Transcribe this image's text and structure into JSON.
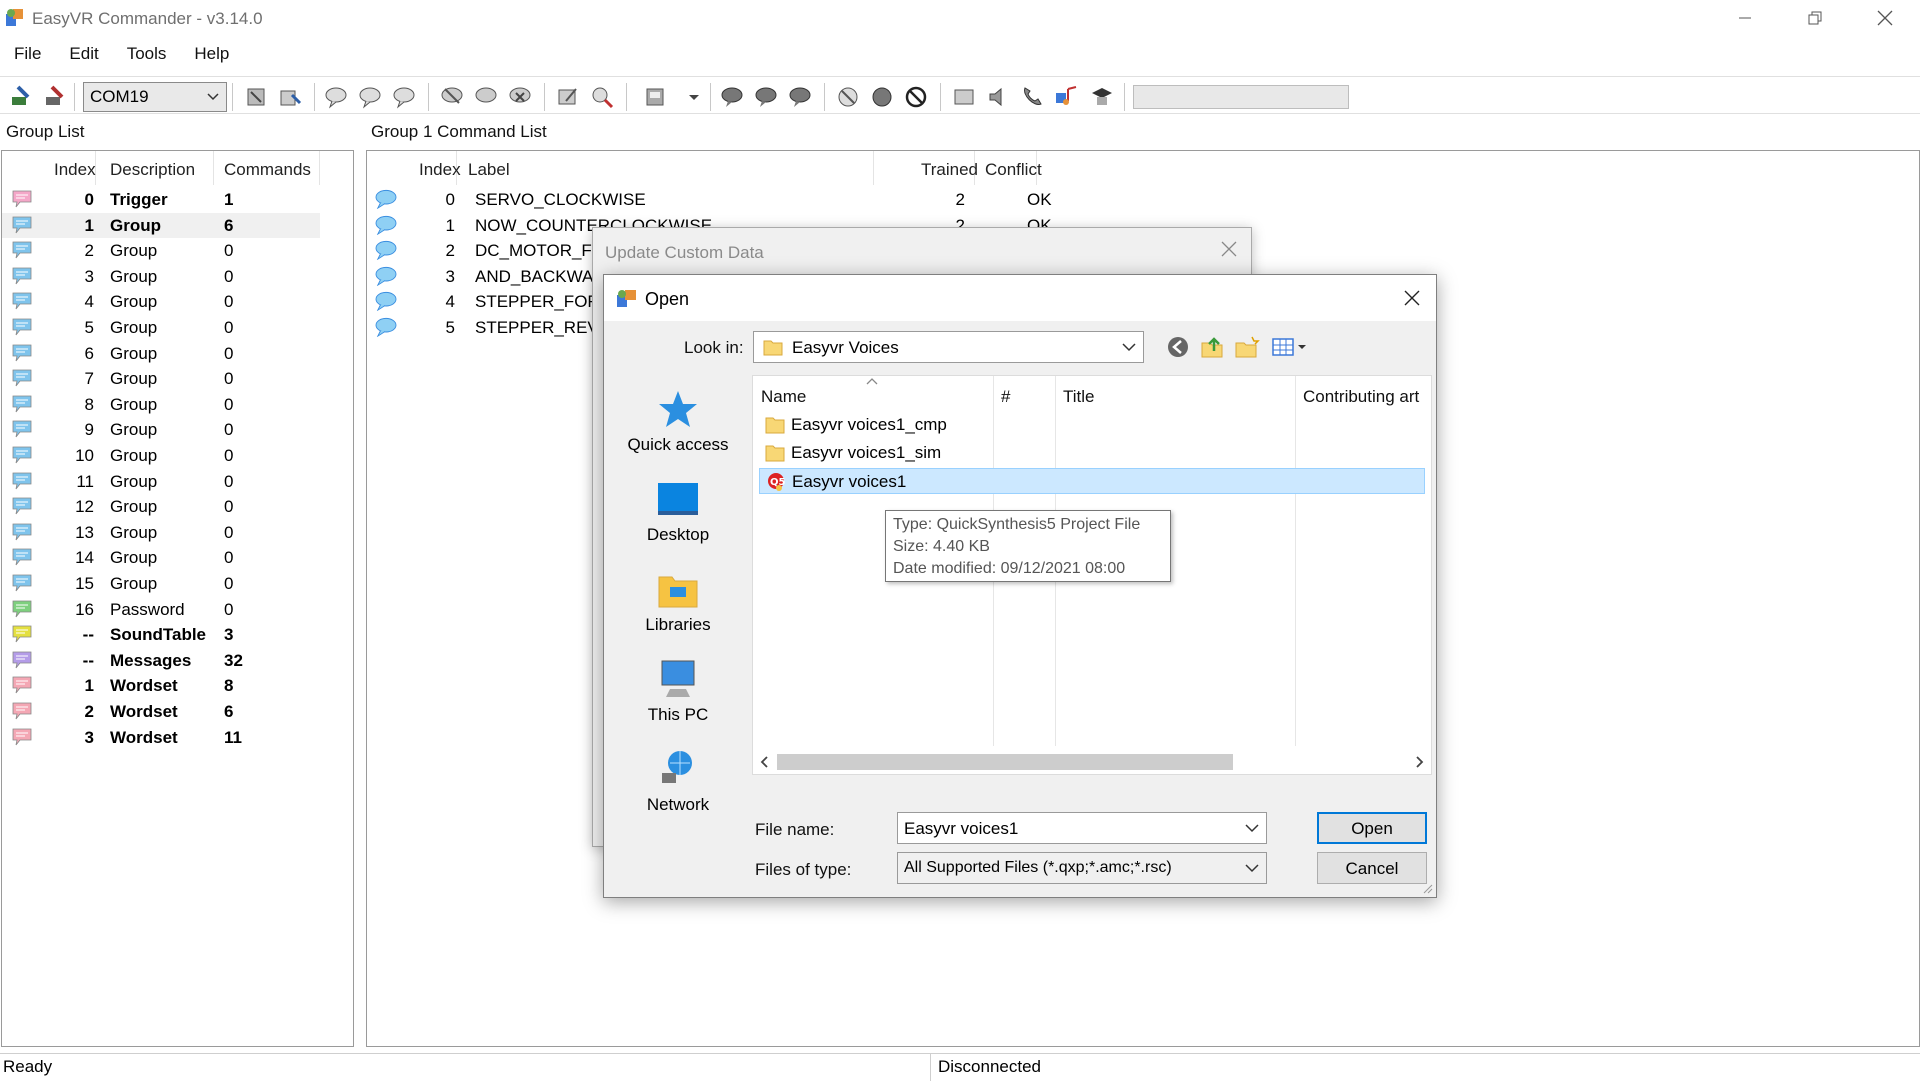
{
  "window": {
    "title": "EasyVR Commander - v3.14.0"
  },
  "menu": [
    "File",
    "Edit",
    "Tools",
    "Help"
  ],
  "toolbar": {
    "com_port": "COM19"
  },
  "group_list": {
    "header": "Group List",
    "columns": [
      "Index",
      "Description",
      "Commands"
    ],
    "rows": [
      {
        "index": "0",
        "description": "Trigger",
        "commands": "1",
        "bold": true,
        "color": "#f4a7c8"
      },
      {
        "index": "1",
        "description": "Group",
        "commands": "6",
        "bold": true,
        "color": "#7fc4ec"
      },
      {
        "index": "2",
        "description": "Group",
        "commands": "0",
        "bold": false,
        "color": "#7fc4ec"
      },
      {
        "index": "3",
        "description": "Group",
        "commands": "0",
        "bold": false,
        "color": "#7fc4ec"
      },
      {
        "index": "4",
        "description": "Group",
        "commands": "0",
        "bold": false,
        "color": "#7fc4ec"
      },
      {
        "index": "5",
        "description": "Group",
        "commands": "0",
        "bold": false,
        "color": "#7fc4ec"
      },
      {
        "index": "6",
        "description": "Group",
        "commands": "0",
        "bold": false,
        "color": "#7fc4ec"
      },
      {
        "index": "7",
        "description": "Group",
        "commands": "0",
        "bold": false,
        "color": "#7fc4ec"
      },
      {
        "index": "8",
        "description": "Group",
        "commands": "0",
        "bold": false,
        "color": "#7fc4ec"
      },
      {
        "index": "9",
        "description": "Group",
        "commands": "0",
        "bold": false,
        "color": "#7fc4ec"
      },
      {
        "index": "10",
        "description": "Group",
        "commands": "0",
        "bold": false,
        "color": "#7fc4ec"
      },
      {
        "index": "11",
        "description": "Group",
        "commands": "0",
        "bold": false,
        "color": "#7fc4ec"
      },
      {
        "index": "12",
        "description": "Group",
        "commands": "0",
        "bold": false,
        "color": "#7fc4ec"
      },
      {
        "index": "13",
        "description": "Group",
        "commands": "0",
        "bold": false,
        "color": "#7fc4ec"
      },
      {
        "index": "14",
        "description": "Group",
        "commands": "0",
        "bold": false,
        "color": "#7fc4ec"
      },
      {
        "index": "15",
        "description": "Group",
        "commands": "0",
        "bold": false,
        "color": "#7fc4ec"
      },
      {
        "index": "16",
        "description": "Password",
        "commands": "0",
        "bold": false,
        "color": "#7ed07e"
      },
      {
        "index": "--",
        "description": "SoundTable",
        "commands": "3",
        "bold": true,
        "color": "#e4e040"
      },
      {
        "index": "--",
        "description": "Messages",
        "commands": "32",
        "bold": true,
        "color": "#b49ce8"
      },
      {
        "index": "1",
        "description": "Wordset",
        "commands": "8",
        "bold": true,
        "color": "#f4a7b4"
      },
      {
        "index": "2",
        "description": "Wordset",
        "commands": "6",
        "bold": true,
        "color": "#f4a7b4"
      },
      {
        "index": "3",
        "description": "Wordset",
        "commands": "11",
        "bold": true,
        "color": "#f4a7b4"
      }
    ]
  },
  "command_list": {
    "header": "Group 1 Command List",
    "columns": [
      "Index",
      "Label",
      "Trained",
      "Conflict"
    ],
    "rows": [
      {
        "index": "0",
        "label": "SERVO_CLOCKWISE",
        "trained": "2",
        "conflict": "OK"
      },
      {
        "index": "1",
        "label": "NOW_COUNTERCLOCKWISE",
        "trained": "2",
        "conflict": "OK"
      },
      {
        "index": "2",
        "label": "DC_MOTOR_FO",
        "trained": "",
        "conflict": ""
      },
      {
        "index": "3",
        "label": "AND_BACKWAR",
        "trained": "",
        "conflict": ""
      },
      {
        "index": "4",
        "label": "STEPPER_FOR",
        "trained": "",
        "conflict": ""
      },
      {
        "index": "5",
        "label": "STEPPER_REV",
        "trained": "",
        "conflict": ""
      }
    ]
  },
  "update_dialog": {
    "title": "Update Custom Data"
  },
  "open_dialog": {
    "title": "Open",
    "look_in_label": "Look in:",
    "look_in_value": "Easyvr Voices",
    "places": [
      "Quick access",
      "Desktop",
      "Libraries",
      "This PC",
      "Network"
    ],
    "file_columns": [
      "Name",
      "#",
      "Title",
      "Contributing art"
    ],
    "files": [
      {
        "name": "Easyvr voices1_cmp",
        "type": "folder"
      },
      {
        "name": "Easyvr voices1_sim",
        "type": "folder"
      },
      {
        "name": "Easyvr voices1",
        "type": "project"
      }
    ],
    "tooltip": {
      "type": "Type: QuickSynthesis5 Project File",
      "size": "Size: 4.40 KB",
      "modified": "Date modified: 09/12/2021 08:00"
    },
    "file_name_label": "File name:",
    "file_name_value": "Easyvr voices1",
    "file_type_label": "Files of type:",
    "file_type_value": "All Supported Files (*.qxp;*.amc;*.rsc)",
    "open_button": "Open",
    "cancel_button": "Cancel"
  },
  "status": {
    "left": "Ready",
    "right": "Disconnected"
  }
}
